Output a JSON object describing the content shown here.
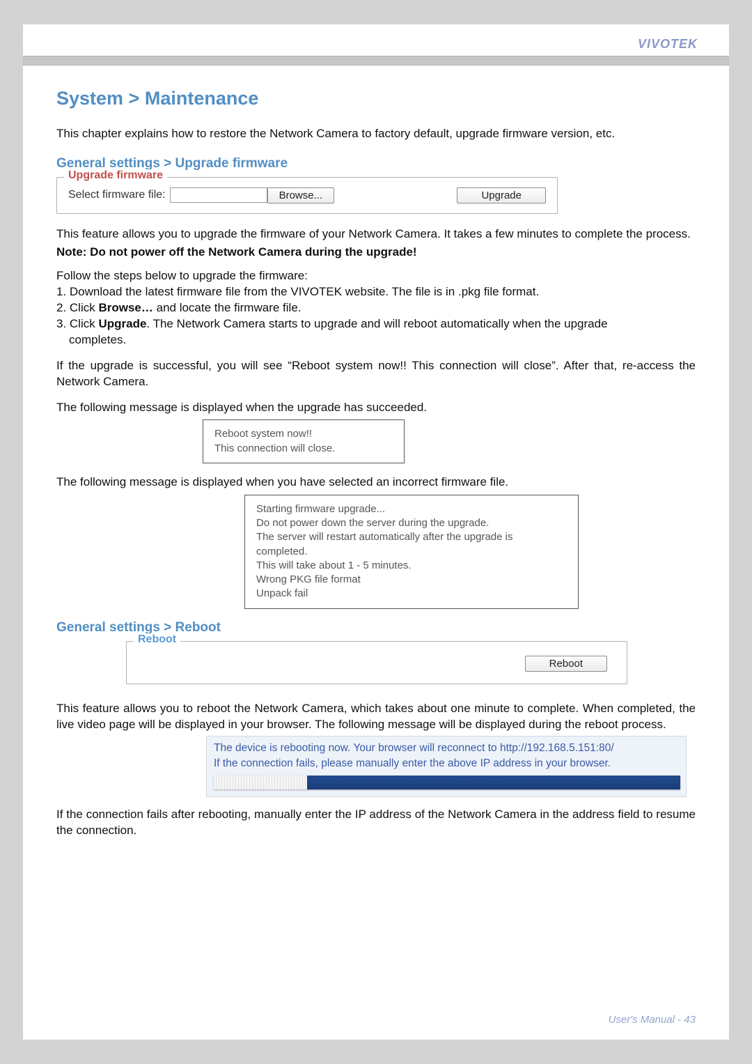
{
  "brand": "VIVOTEK",
  "page_title": "System > Maintenance",
  "intro": "This chapter explains how to restore the Network Camera to factory default, upgrade firmware version, etc.",
  "section1": {
    "heading": "General settings > Upgrade firmware",
    "legend": "Upgrade firmware",
    "file_label": "Select firmware file:",
    "browse": "Browse...",
    "upgrade": "Upgrade"
  },
  "fw_desc": "This feature allows you to upgrade the firmware of your Network Camera. It takes a few minutes to complete the process.",
  "fw_note": "Note: Do not power off the Network Camera during the upgrade!",
  "steps_intro": "Follow the steps below to upgrade the firmware:",
  "step1": "1. Download the latest firmware file from the VIVOTEK website. The file is in .pkg file format.",
  "step2_a": "2. Click ",
  "step2_b": "Browse…",
  "step2_c": " and locate the firmware file.",
  "step3_a": "3. Click ",
  "step3_b": "Upgrade",
  "step3_c": ". The Network Camera starts to upgrade and will reboot automatically when the upgrade",
  "step3_d": "completes.",
  "success_para": "If the upgrade is successful, you will see “Reboot system now!! This connection will close”. After that, re-access the Network Camera.",
  "succeed_intro": "The following message is displayed when the upgrade has succeeded.",
  "succeed_msg_l1": "Reboot system now!!",
  "succeed_msg_l2": "This connection will close.",
  "fail_intro": "The following message is displayed when you have selected an incorrect firmware file.",
  "fail_msg": {
    "l1": "Starting firmware upgrade...",
    "l2": "Do not power down the server during the upgrade.",
    "l3": "The server will restart automatically after the upgrade is",
    "l4": "completed.",
    "l5": "This will take about 1 - 5 minutes.",
    "l6": "Wrong PKG file format",
    "l7": "Unpack fail"
  },
  "section2": {
    "heading": "General settings > Reboot",
    "legend": "Reboot",
    "button": "Reboot"
  },
  "reboot_desc": "This feature allows you to reboot the Network Camera, which takes about one minute to complete. When completed, the live video page will be displayed in your browser. The following message will be displayed during the reboot process.",
  "reboot_msg": {
    "l1": "The device is rebooting now. Your browser will reconnect to http://192.168.5.151:80/",
    "l2": "If the connection fails, please manually enter the above IP address in your browser.",
    "progress_percent": 20
  },
  "tail": "If the connection fails after rebooting, manually enter the IP address of the Network Camera in the address field to resume the connection.",
  "footer": "User's Manual - 43"
}
